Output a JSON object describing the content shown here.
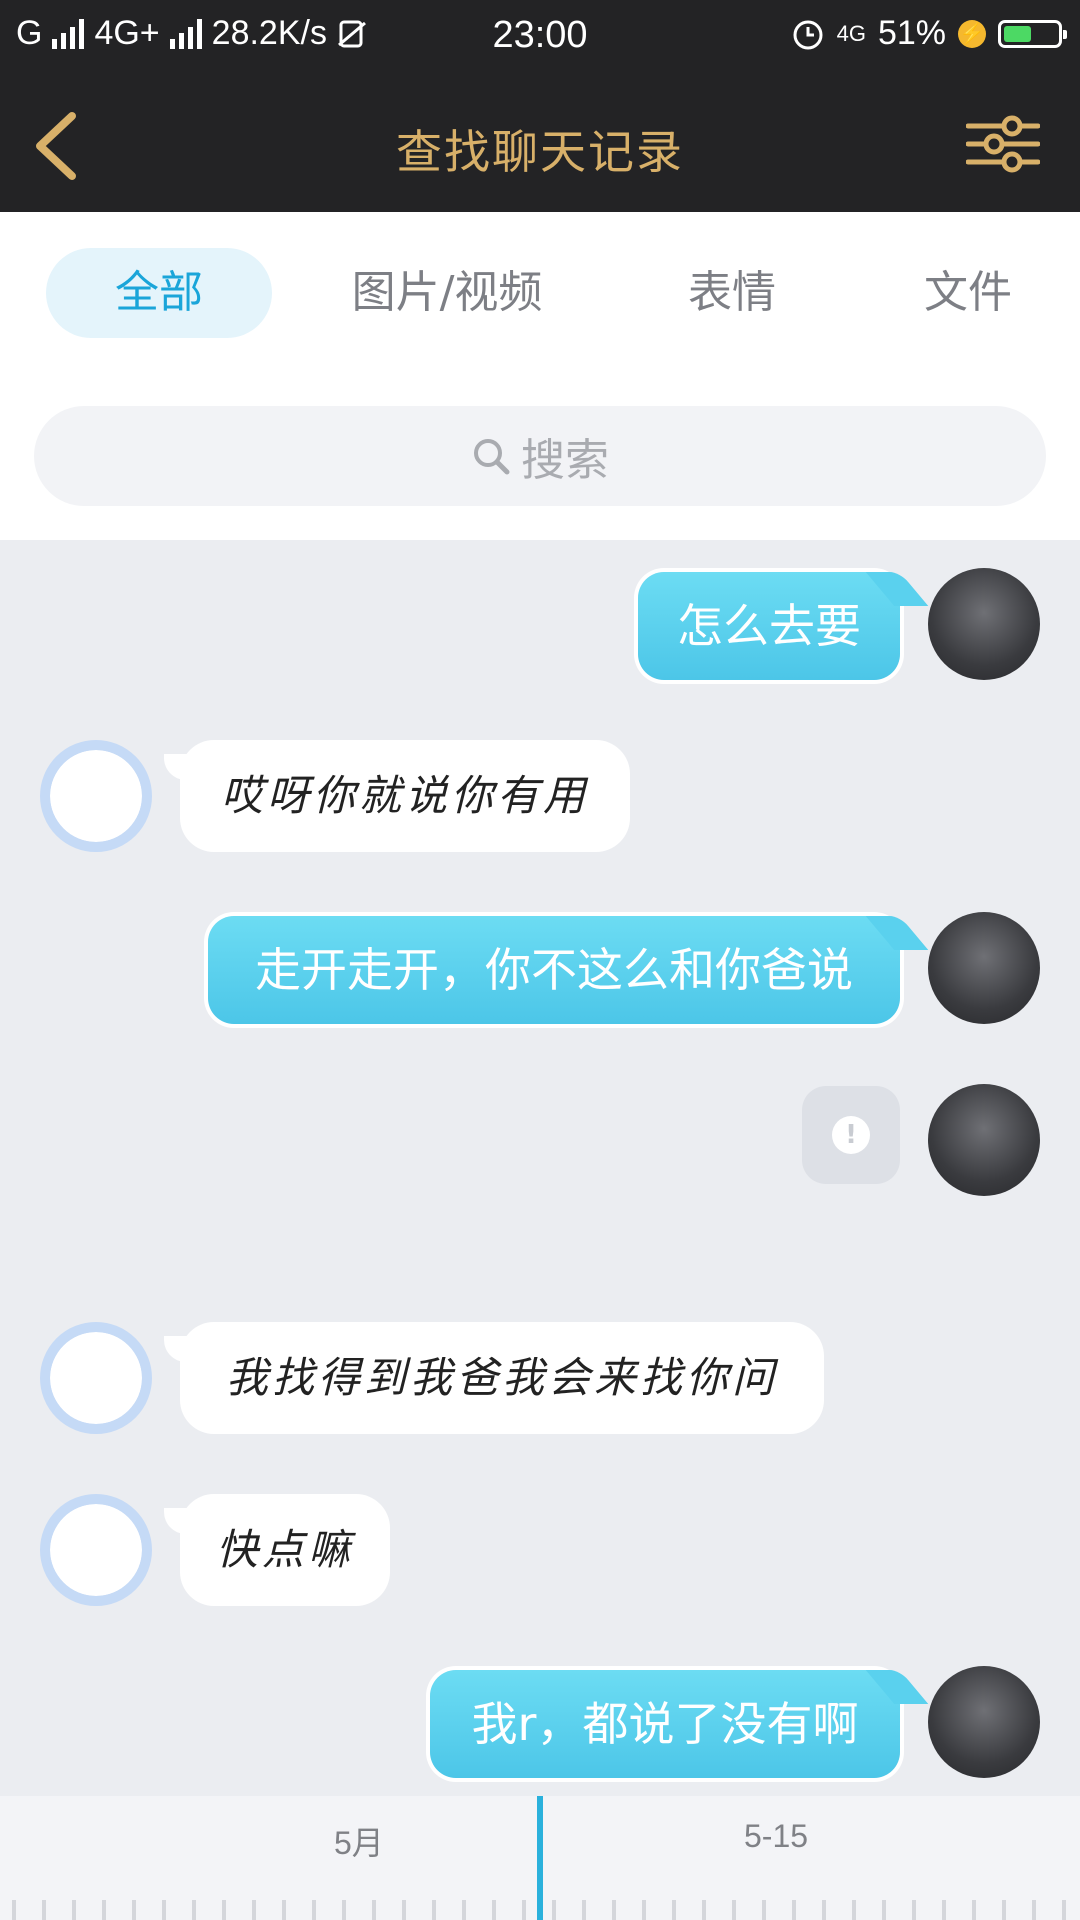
{
  "status_bar": {
    "carrier1": "G",
    "carrier2": "4G+",
    "speed": "28.2K/s",
    "time": "23:00",
    "network": "4G",
    "battery_text": "51%",
    "battery_level": 0.51
  },
  "nav": {
    "title": "查找聊天记录"
  },
  "tabs": [
    {
      "label": "全部",
      "active": true
    },
    {
      "label": "图片/视频",
      "active": false
    },
    {
      "label": "表情",
      "active": false
    },
    {
      "label": "文件",
      "active": false
    }
  ],
  "search": {
    "placeholder": "搜索"
  },
  "messages": [
    {
      "side": "mine",
      "text": "怎么去要"
    },
    {
      "side": "theirs",
      "text": "哎呀你就说你有用"
    },
    {
      "side": "mine",
      "text": "走开走开，你不这么和你爸说"
    },
    {
      "side": "mine",
      "text": "",
      "type": "failed"
    },
    {
      "side": "theirs",
      "text": "我找得到我爸我会来找你问"
    },
    {
      "side": "theirs",
      "text": "快点嘛"
    },
    {
      "side": "mine",
      "text": "我r，都说了没有啊"
    }
  ],
  "timeline": {
    "label_left": "5月",
    "label_right": "5-15"
  },
  "colors": {
    "accent": "#1aa5d9",
    "nav_title": "#d8b069",
    "bubble_out": "#4cc6e8"
  }
}
